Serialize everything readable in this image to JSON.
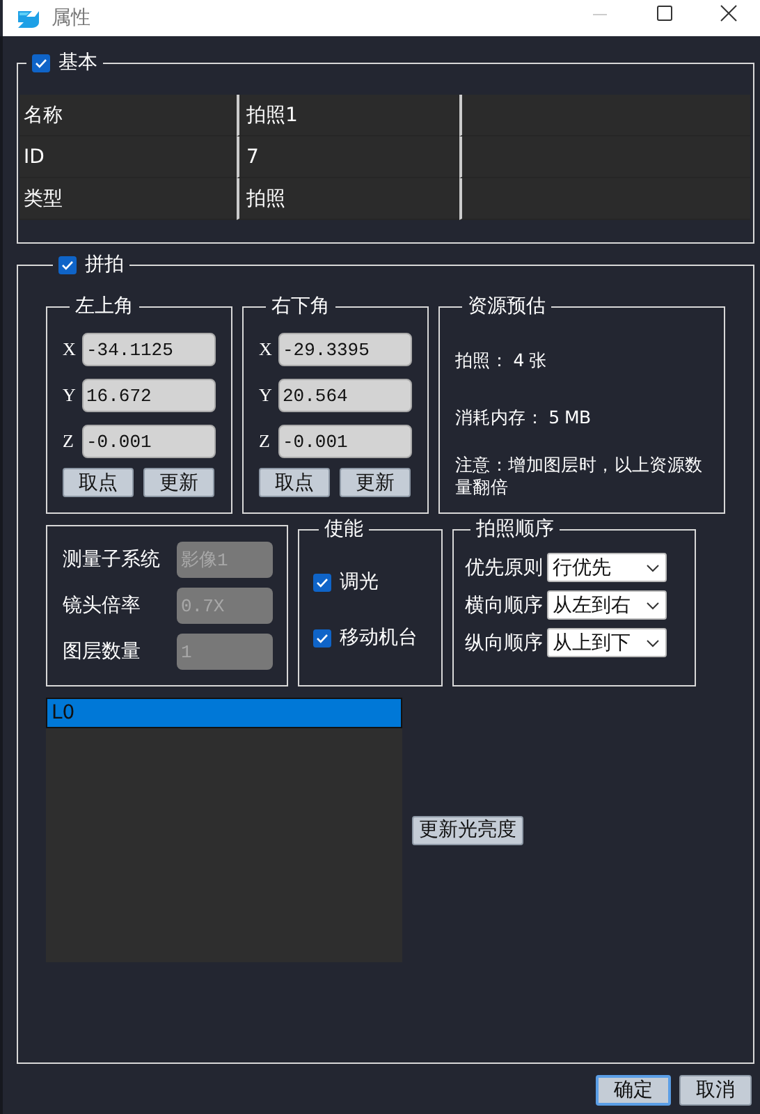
{
  "window": {
    "title": "属性"
  },
  "basic": {
    "title": "基本",
    "checked": true,
    "rows": [
      {
        "label": "名称",
        "value": "拍照1"
      },
      {
        "label": "ID",
        "value": "7"
      },
      {
        "label": "类型",
        "value": "拍照"
      }
    ]
  },
  "stitch": {
    "title": "拼拍",
    "checked": true,
    "corners": [
      {
        "title": "左上角",
        "fields": [
          {
            "axis": "X",
            "value": "-34.1125"
          },
          {
            "axis": "Y",
            "value": "16.672"
          },
          {
            "axis": "Z",
            "value": "-0.001"
          }
        ],
        "buttons": [
          "取点",
          "更新"
        ]
      },
      {
        "title": "右下角",
        "fields": [
          {
            "axis": "X",
            "value": "-29.3395"
          },
          {
            "axis": "Y",
            "value": "20.564"
          },
          {
            "axis": "Z",
            "value": "-0.001"
          }
        ],
        "buttons": [
          "取点",
          "更新"
        ]
      }
    ],
    "estimate": {
      "title": "资源预估",
      "lines": [
        "拍照： 4 张",
        "消耗内存： 5 MB",
        "注意：增加图层时，以上资源数量翻倍"
      ]
    },
    "info": [
      {
        "label": "测量子系统",
        "value": "影像1",
        "disabled": true
      },
      {
        "label": "镜头倍率",
        "value": "0.7X",
        "disabled": true
      },
      {
        "label": "图层数量",
        "value": "1",
        "disabled": true
      }
    ],
    "enable": {
      "title": "使能",
      "options": [
        {
          "label": "调光",
          "checked": true
        },
        {
          "label": "移动机台",
          "checked": true
        }
      ]
    },
    "order": {
      "title": "拍照顺序",
      "rows": [
        {
          "label": "优先原则",
          "value": "行优先"
        },
        {
          "label": "横向顺序",
          "value": "从左到右"
        },
        {
          "label": "纵向顺序",
          "value": "从上到下"
        }
      ]
    },
    "layers": [
      {
        "label": "L0",
        "selected": true
      }
    ],
    "brightness_button": "更新光亮度"
  },
  "buttons": [
    {
      "label": "确定",
      "default": true
    },
    {
      "label": "取消",
      "default": false
    }
  ]
}
